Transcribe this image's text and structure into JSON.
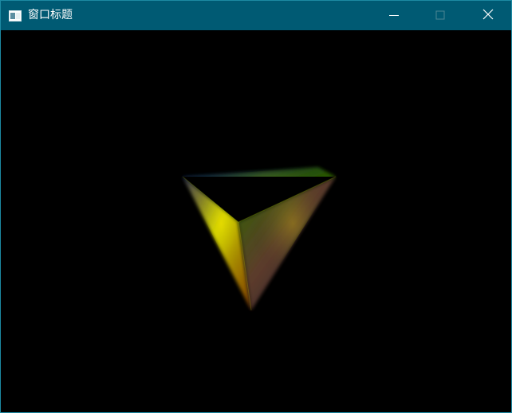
{
  "window": {
    "title": "窗口标题",
    "icon": "window-app-icon",
    "controls": {
      "minimize_icon": "minimize-icon",
      "maximize_icon": "maximize-icon",
      "close_icon": "close-icon"
    }
  },
  "colors": {
    "titlebar": "#005a73",
    "border": "#1d8aa3",
    "viewport": "#000000",
    "cube_top": "#2c6a00",
    "cube_front": "#8aa800",
    "cube_side": "#3a2a6a"
  },
  "viewport": {
    "scene": "rotating-color-cube"
  }
}
